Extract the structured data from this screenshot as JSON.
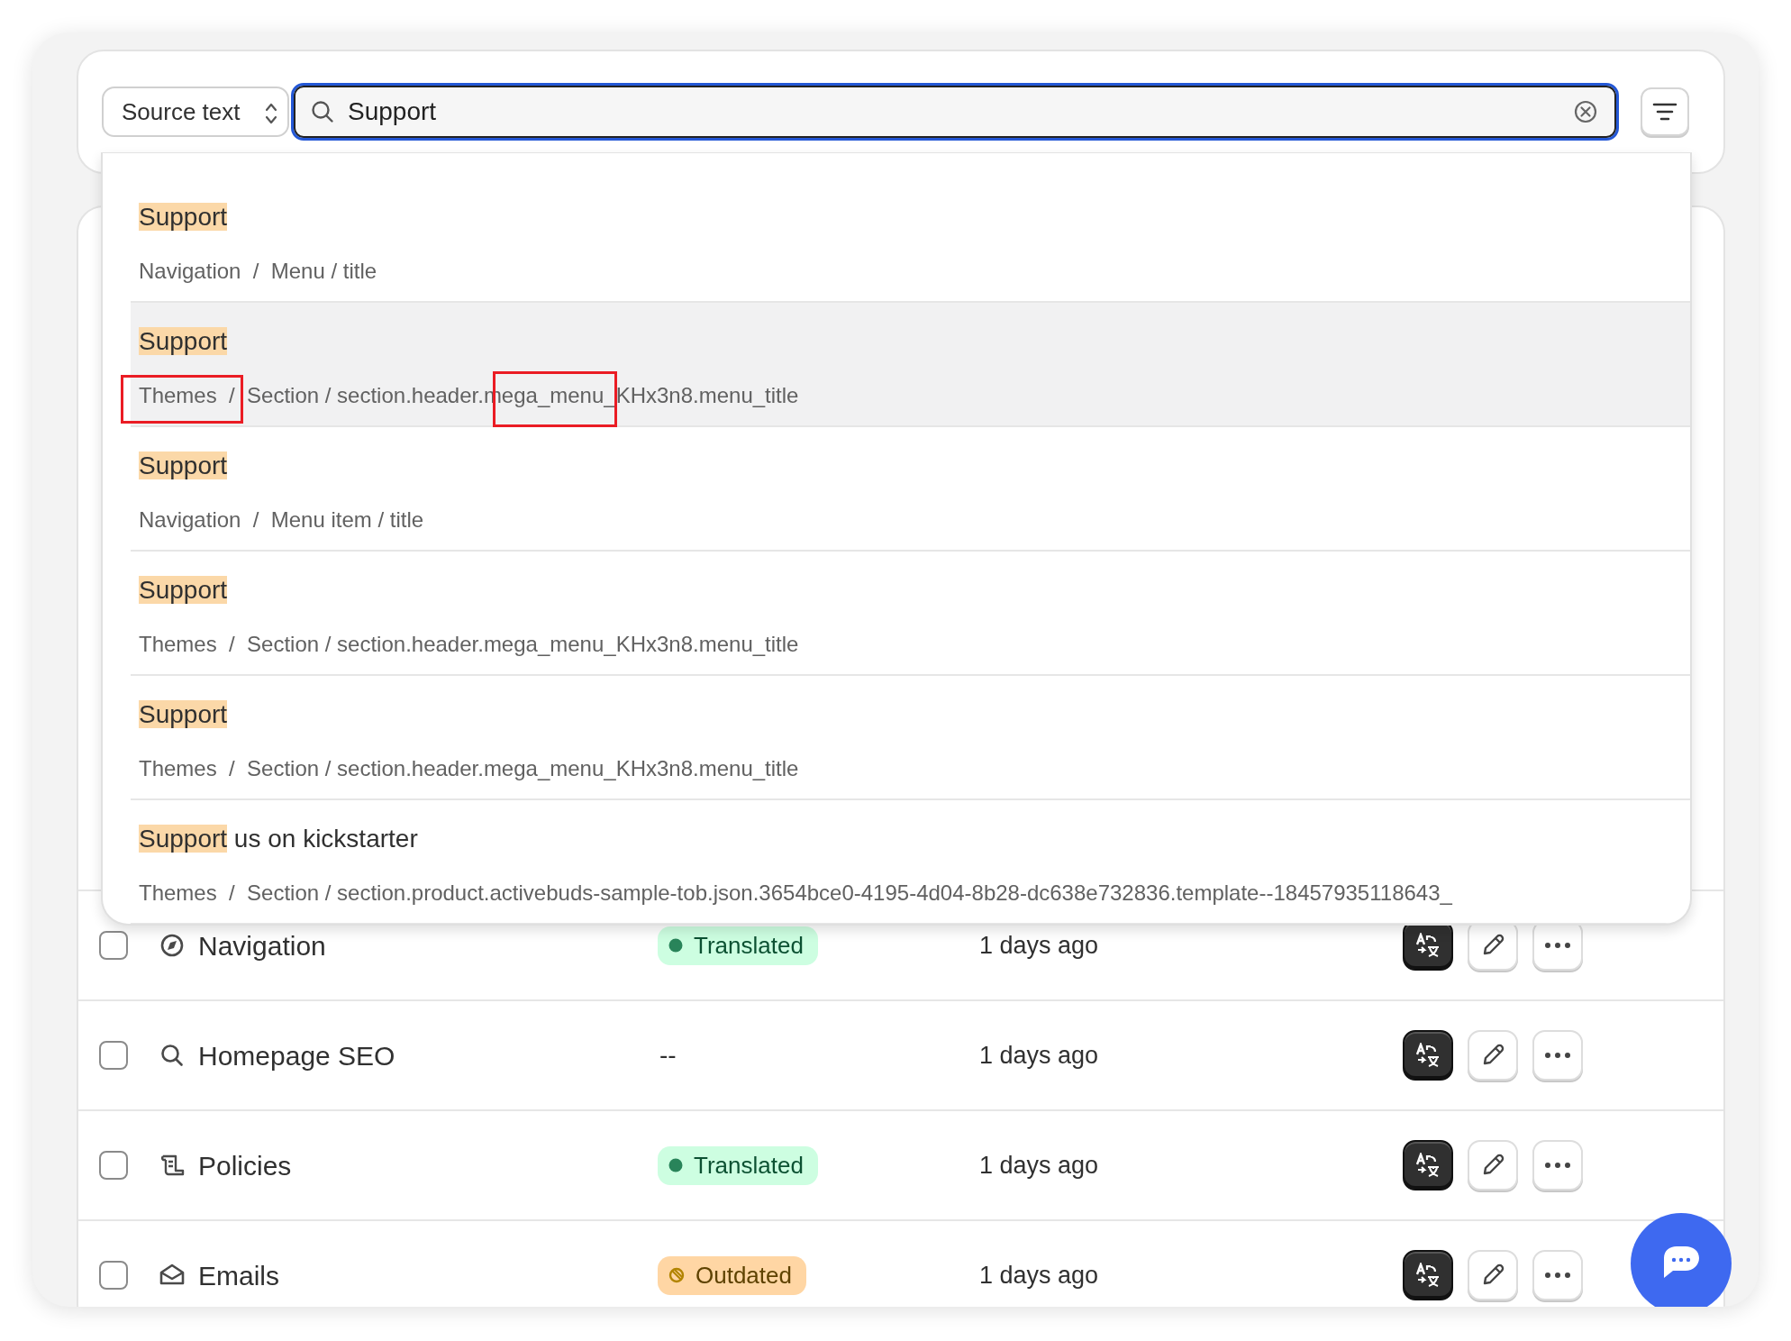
{
  "search": {
    "scope": "Source text",
    "query": "Support"
  },
  "results": [
    {
      "match": "Support",
      "path": "Navigation  /  Menu / title",
      "hovered": false,
      "annotated": false
    },
    {
      "match": "Support",
      "path": "Themes  /  Section / section.header.mega_menu_KHx3n8.menu_title",
      "hovered": true,
      "annotated": true
    },
    {
      "match": "Support",
      "path": "Navigation  /  Menu item / title",
      "hovered": false,
      "annotated": false
    },
    {
      "match": "Support",
      "path": "Themes  /  Section / section.header.mega_menu_KHx3n8.menu_title",
      "hovered": false,
      "annotated": false
    },
    {
      "match": "Support",
      "path": "Themes  /  Section / section.header.mega_menu_KHx3n8.menu_title",
      "hovered": false,
      "annotated": false
    },
    {
      "match": "Support",
      "rest": " us on kickstarter",
      "path": "Themes  /  Section / section.product.activebuds-sample-tob.json.3654bce0-4195-4d04-8b28-dc638e732836.template--18457935118643_",
      "hovered": false,
      "annotated": false
    }
  ],
  "rows": [
    {
      "checked": false,
      "kind": "navigation",
      "name": "Navigation",
      "status": {
        "kind": "translated",
        "label": "Translated"
      },
      "updated": "1 days ago"
    },
    {
      "checked": false,
      "kind": "seo",
      "name": "Homepage SEO",
      "status": {
        "kind": "none",
        "label": "--"
      },
      "updated": "1 days ago"
    },
    {
      "checked": false,
      "kind": "policies",
      "name": "Policies",
      "status": {
        "kind": "translated",
        "label": "Translated"
      },
      "updated": "1 days ago"
    },
    {
      "checked": false,
      "kind": "emails",
      "name": "Emails",
      "status": {
        "kind": "outdated",
        "label": "Outdated"
      },
      "updated": "1 days ago"
    }
  ]
}
